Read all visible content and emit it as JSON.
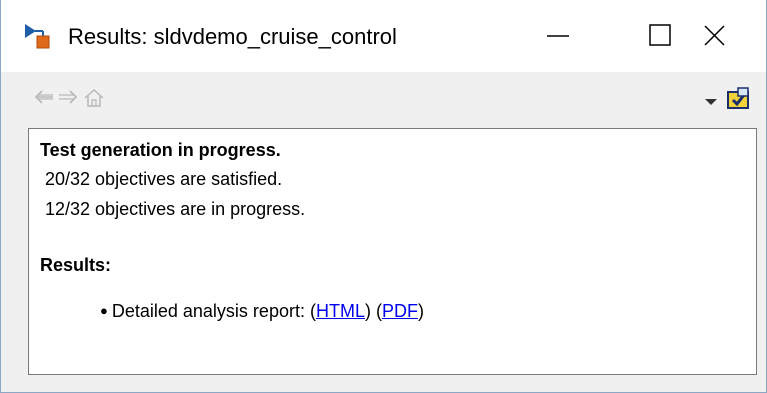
{
  "window": {
    "title": "Results: sldvdemo_cruise_control",
    "icon": "simulink-design-verifier-icon"
  },
  "title_buttons": {
    "minimize": "minimize-icon",
    "maximize": "maximize-icon",
    "close": "close-icon"
  },
  "toolbar": {
    "back": "back-arrow-icon",
    "forward": "forward-arrow-icon",
    "home": "home-icon",
    "menu": "dropdown-arrow-icon",
    "tool": "highlight-model-icon"
  },
  "content": {
    "heading_progress": "Test generation in progress.",
    "line_satisfied": "20/32 objectives are satisfied.",
    "line_in_progress": "12/32 objectives are in progress.",
    "heading_results": "Results:",
    "bullet_text": "Detailed analysis report: ",
    "open_paren_1": "(",
    "link_html": "HTML",
    "mid_paren": ") (",
    "link_pdf": "PDF",
    "close_paren": ")"
  },
  "colors": {
    "link": "#0000ee",
    "border": "#7a7a7a",
    "toolbar_bg": "#f0f0f0"
  }
}
